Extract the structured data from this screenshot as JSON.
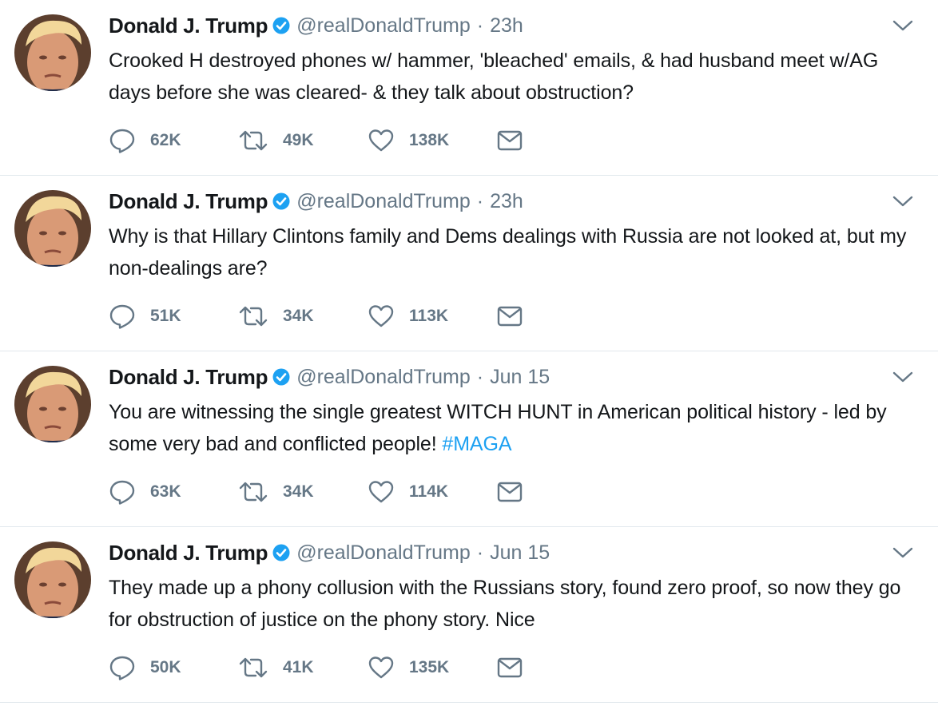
{
  "colors": {
    "text": "#14171a",
    "muted": "#657786",
    "accent": "#1da1f2",
    "divider": "#e1e8ed"
  },
  "icons": [
    "avatar",
    "verified-badge-icon",
    "caret-down-icon",
    "reply-icon",
    "retweet-icon",
    "like-icon",
    "direct-message-icon"
  ],
  "tweets": [
    {
      "name": "Donald J. Trump",
      "handle": "@realDonaldTrump",
      "separator": "·",
      "time": "23h",
      "text": "Crooked H destroyed phones w/ hammer, 'bleached' emails, & had husband meet w/AG days before she was cleared- & they talk about obstruction?",
      "hashtag": "",
      "replies": "62K",
      "retweets": "49K",
      "likes": "138K"
    },
    {
      "name": "Donald J. Trump",
      "handle": "@realDonaldTrump",
      "separator": "·",
      "time": "23h",
      "text": "Why is that Hillary Clintons family and Dems dealings with Russia are not looked at, but my non-dealings are?",
      "hashtag": "",
      "replies": "51K",
      "retweets": "34K",
      "likes": "113K"
    },
    {
      "name": "Donald J. Trump",
      "handle": "@realDonaldTrump",
      "separator": "·",
      "time": "Jun 15",
      "text": "You are witnessing the single greatest WITCH HUNT in American political history - led by some very bad and conflicted people! ",
      "hashtag": "#MAGA",
      "replies": "63K",
      "retweets": "34K",
      "likes": "114K"
    },
    {
      "name": "Donald J. Trump",
      "handle": "@realDonaldTrump",
      "separator": "·",
      "time": "Jun 15",
      "text": "They made up a phony collusion with the Russians story, found zero proof, so now they go for obstruction of justice on the phony story. Nice",
      "hashtag": "",
      "replies": "50K",
      "retweets": "41K",
      "likes": "135K"
    }
  ]
}
